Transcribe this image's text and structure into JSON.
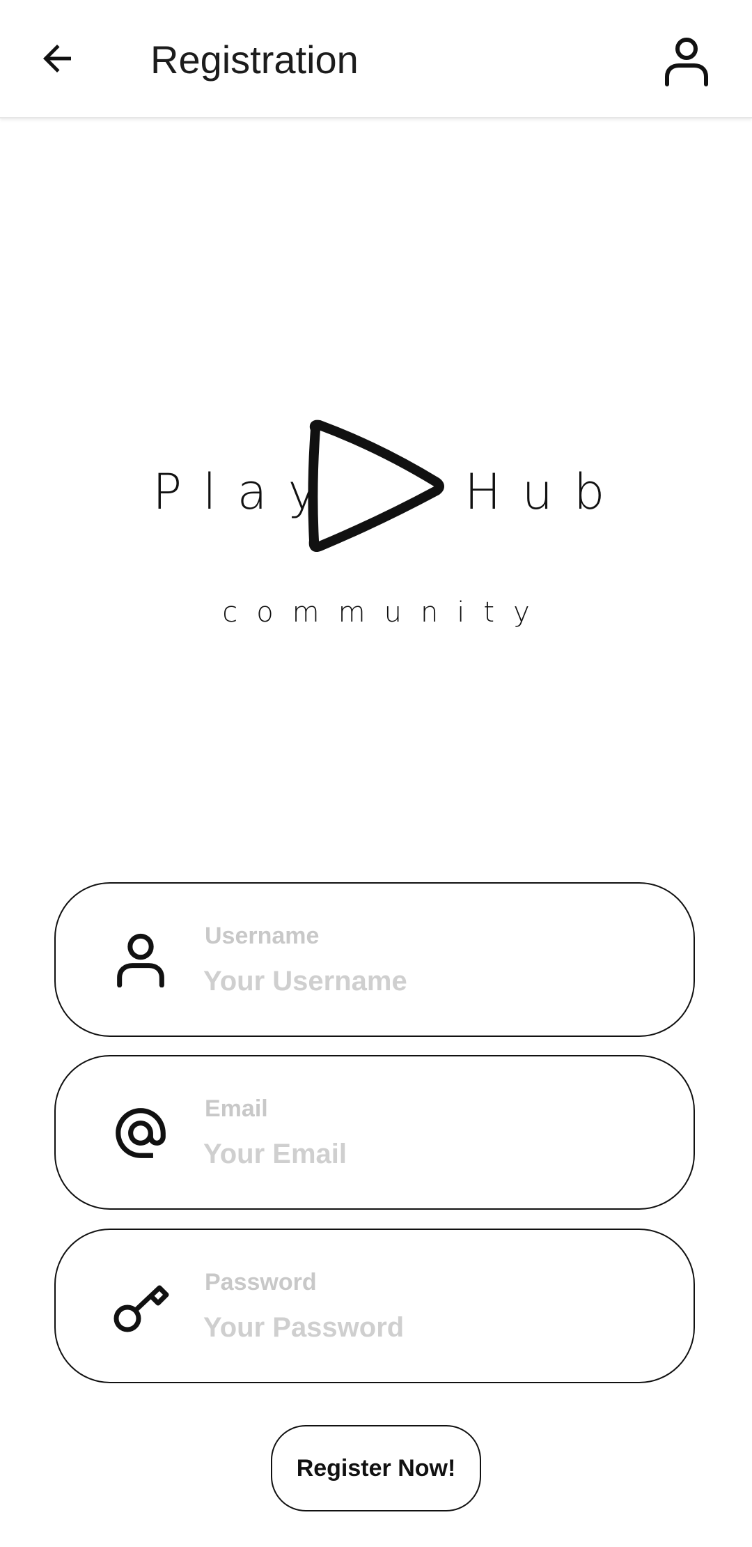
{
  "appbar": {
    "title": "Registration",
    "back_icon": "arrow-back-icon",
    "profile_icon": "person-icon"
  },
  "logo": {
    "word_left": "Play",
    "word_right": "Hub",
    "subtitle": "community",
    "play_icon": "play-triangle-icon"
  },
  "form": {
    "username": {
      "label": "Username",
      "placeholder": "Your Username",
      "value": "",
      "icon": "person-icon"
    },
    "email": {
      "label": "Email",
      "placeholder": "Your Email",
      "value": "",
      "icon": "at-sign-icon"
    },
    "password": {
      "label": "Password",
      "placeholder": "Your Password",
      "value": "",
      "icon": "key-icon"
    },
    "submit_label": "Register Now!"
  },
  "colors": {
    "background": "#ffffff",
    "foreground": "#111111",
    "placeholder": "#cfcfcf"
  }
}
